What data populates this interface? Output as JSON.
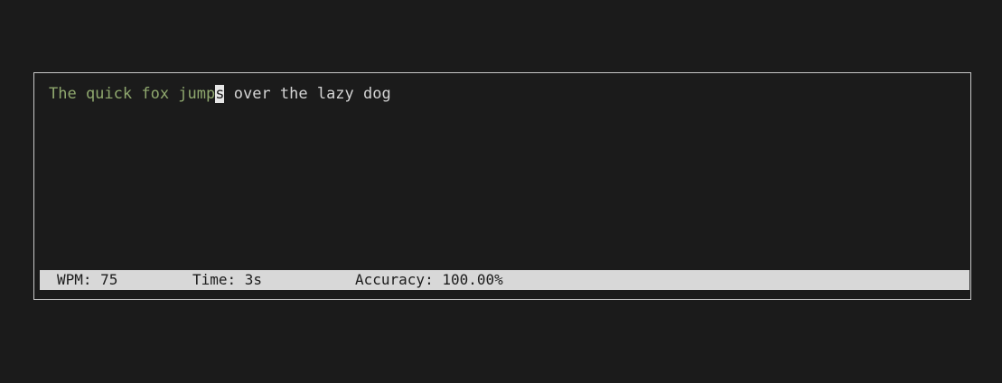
{
  "typing": {
    "typed_text": "The quick fox jump",
    "cursor_char": "s",
    "remaining_text": " over the lazy dog"
  },
  "status": {
    "wpm": "WPM: 75",
    "time": "Time: 3s",
    "accuracy": "Accuracy: 100.00%"
  },
  "colors": {
    "background": "#1b1b1b",
    "typed": "#8fa86e",
    "untyped": "#d4d4d4",
    "cursor_bg": "#e6e6e6",
    "status_bg": "#d8d8d8"
  }
}
